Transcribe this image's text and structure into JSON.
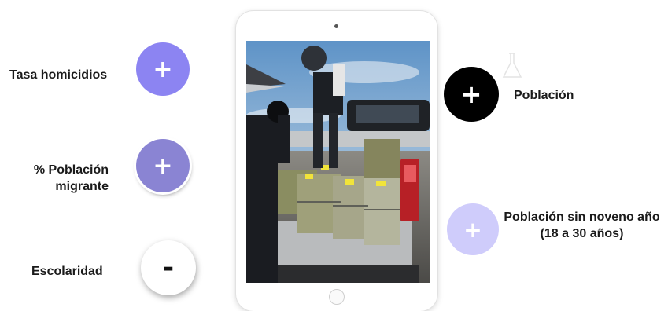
{
  "left_factors": [
    {
      "label": "Tasa homicidios",
      "sign": "+",
      "color": "#8c84f2"
    },
    {
      "label_line1": "% Población",
      "label_line2": "migrante",
      "sign": "+",
      "color": "#8a84d3"
    },
    {
      "label": "Escolaridad",
      "sign": "-",
      "color": "#ffffff"
    }
  ],
  "right_factors": [
    {
      "label": "Población",
      "sign": "+",
      "color": "#000000"
    },
    {
      "label_line1": "Población sin noveno año",
      "label_line2": "(18 a 30 años)",
      "sign": "+",
      "color": "#cfccfb"
    }
  ]
}
